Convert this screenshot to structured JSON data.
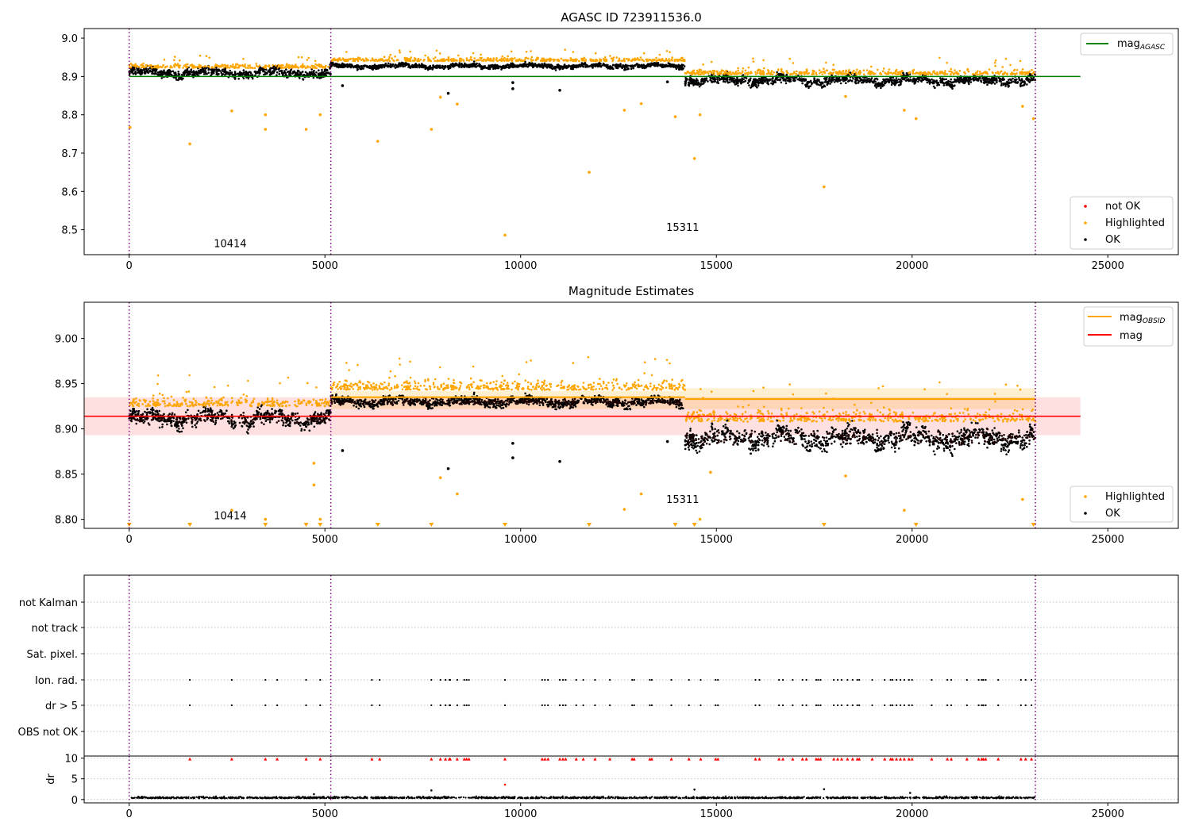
{
  "chart_data": [
    {
      "type": "scatter",
      "title": "AGASC ID 723911536.0",
      "xlim": [
        -1150,
        26800
      ],
      "ylim": [
        8.435,
        9.025
      ],
      "xticks": [
        0,
        5000,
        10000,
        15000,
        20000,
        25000
      ],
      "yticks": [
        8.5,
        8.6,
        8.7,
        8.8,
        8.9,
        9.0
      ],
      "ytick_labels": [
        "8.5",
        "8.6",
        "8.7",
        "8.8",
        "8.9",
        "9.0"
      ],
      "obsid_boundaries": [
        0,
        5150,
        23150
      ],
      "obsid_labels": [
        {
          "text": "10414",
          "x": 2580,
          "y": 8.455
        },
        {
          "text": "15311",
          "x": 14140,
          "y": 8.497
        }
      ],
      "mag_agasc": {
        "name": "mag$_{AGASC}$",
        "label_main": "mag",
        "label_sub": "AGASC",
        "value": 8.9,
        "x": [
          0,
          24300
        ],
        "color": "#008000"
      },
      "segments": [
        {
          "x": [
            0,
            5150
          ],
          "ok_center": 8.909,
          "ok_spread": 0.012,
          "highlight_center": 8.922,
          "highlight_spread": 0.01
        },
        {
          "x": [
            5150,
            14200
          ],
          "ok_center": 8.927,
          "ok_spread": 0.006,
          "highlight_center": 8.94,
          "highlight_spread": 0.008
        },
        {
          "x": [
            14200,
            23150
          ],
          "ok_center": 8.89,
          "ok_spread": 0.012,
          "highlight_center": 8.905,
          "highlight_spread": 0.012
        }
      ],
      "outliers_highlighted": [
        [
          20,
          8.767
        ],
        [
          1550,
          8.724
        ],
        [
          2620,
          8.81
        ],
        [
          3480,
          8.8
        ],
        [
          3480,
          8.762
        ],
        [
          4520,
          8.762
        ],
        [
          4880,
          8.8
        ],
        [
          6350,
          8.731
        ],
        [
          7720,
          8.762
        ],
        [
          7950,
          8.846
        ],
        [
          8380,
          8.828
        ],
        [
          9600,
          8.486
        ],
        [
          11750,
          8.65
        ],
        [
          12650,
          8.812
        ],
        [
          13080,
          8.829
        ],
        [
          13950,
          8.795
        ],
        [
          14440,
          8.686
        ],
        [
          14580,
          8.8
        ],
        [
          17750,
          8.612
        ],
        [
          18300,
          8.848
        ],
        [
          19800,
          8.812
        ],
        [
          20100,
          8.79
        ],
        [
          22820,
          8.822
        ],
        [
          23100,
          8.79
        ]
      ],
      "outliers_ok": [
        [
          5450,
          8.876
        ],
        [
          8150,
          8.856
        ],
        [
          9800,
          8.884
        ],
        [
          9800,
          8.868
        ],
        [
          11000,
          8.864
        ],
        [
          13750,
          8.886
        ]
      ],
      "legend_lines": [
        {
          "name": "mag$_{AGASC}$",
          "color": "#008000"
        }
      ],
      "legend_points": [
        {
          "name": "not OK",
          "color": "#ff0000"
        },
        {
          "name": "Highlighted",
          "color": "#ffa500"
        },
        {
          "name": "OK",
          "color": "#000000"
        }
      ],
      "grid": false
    },
    {
      "type": "scatter",
      "title": "Magnitude Estimates",
      "xlim": [
        -1150,
        26800
      ],
      "ylim": [
        8.79,
        9.04
      ],
      "xticks": [
        0,
        5000,
        10000,
        15000,
        20000,
        25000
      ],
      "yticks": [
        8.8,
        8.85,
        8.9,
        8.95,
        9.0
      ],
      "ytick_labels": [
        "8.80",
        "8.85",
        "8.90",
        "8.95",
        "9.00"
      ],
      "obsid_boundaries": [
        0,
        5150,
        23150
      ],
      "obsid_labels": [
        {
          "text": "10414",
          "x": 2580,
          "y": 8.8
        },
        {
          "text": "15311",
          "x": 14140,
          "y": 8.818
        }
      ],
      "mag": {
        "name": "mag",
        "value": 8.914,
        "band": [
          8.893,
          8.935
        ],
        "x": [
          -1150,
          24300
        ],
        "color": "#ff0000"
      },
      "mag_obsid": {
        "name": "mag$_{OBSID}$",
        "label_main": "mag",
        "label_sub": "OBSID",
        "color": "#ffa500",
        "steps": [
          {
            "x": [
              5150,
              14200
            ],
            "value": 8.935,
            "band": [
              8.922,
              8.942
            ]
          },
          {
            "x": [
              14200,
              23150
            ],
            "value": 8.933,
            "band": [
              8.922,
              8.945
            ]
          }
        ]
      },
      "segments": [
        {
          "x": [
            0,
            5150
          ],
          "ok_center": 8.912,
          "ok_spread": 0.009,
          "highlight_center": 8.925,
          "highlight_spread": 0.01
        },
        {
          "x": [
            5150,
            14200
          ],
          "ok_center": 8.93,
          "ok_spread": 0.005,
          "highlight_center": 8.943,
          "highlight_spread": 0.01
        },
        {
          "x": [
            14200,
            23150
          ],
          "ok_center": 8.89,
          "ok_spread": 0.011,
          "highlight_center": 8.908,
          "highlight_spread": 0.012
        }
      ],
      "outliers_highlighted": [
        [
          2620,
          8.81
        ],
        [
          3480,
          8.8
        ],
        [
          4720,
          8.862
        ],
        [
          4720,
          8.838
        ],
        [
          4880,
          8.8
        ],
        [
          7950,
          8.846
        ],
        [
          8380,
          8.828
        ],
        [
          12650,
          8.811
        ],
        [
          13080,
          8.828
        ],
        [
          14580,
          8.8
        ],
        [
          14850,
          8.852
        ],
        [
          18300,
          8.848
        ],
        [
          19800,
          8.81
        ],
        [
          22820,
          8.822
        ]
      ],
      "outliers_ok": [
        [
          5450,
          8.876
        ],
        [
          8150,
          8.856
        ],
        [
          9800,
          8.884
        ],
        [
          9800,
          8.868
        ],
        [
          11000,
          8.864
        ],
        [
          13750,
          8.886
        ]
      ],
      "floor_markers_x": [
        0,
        1550,
        3480,
        4520,
        4880,
        6350,
        7720,
        9600,
        11750,
        13950,
        14440,
        17750,
        20100,
        23100
      ],
      "legend_lines": [
        {
          "name": "mag$_{OBSID}$",
          "color": "#ffa500"
        },
        {
          "name": "mag",
          "color": "#ff0000"
        }
      ],
      "legend_points": [
        {
          "name": "Highlighted",
          "color": "#ffa500"
        },
        {
          "name": "OK",
          "color": "#000000"
        }
      ],
      "grid": false
    },
    {
      "type": "scatter",
      "title": "",
      "xlim": [
        -1150,
        26800
      ],
      "xticks": [
        0,
        5000,
        10000,
        15000,
        20000,
        25000
      ],
      "obsid_boundaries": [
        0,
        5150,
        23150
      ],
      "flag_categories": [
        "not Kalman",
        "not track",
        "Sat. pixel.",
        "Ion. rad.",
        "dr > 5",
        "OBS not OK"
      ],
      "flag_events_x": [
        1550,
        2620,
        3480,
        3780,
        4520,
        4880,
        6200,
        6400,
        7720,
        7950,
        8080,
        8180,
        8200,
        8380,
        8560,
        8620,
        8680,
        9600,
        10550,
        10620,
        10700,
        11000,
        11080,
        11150,
        11420,
        11600,
        11900,
        12280,
        12850,
        12900,
        13300,
        13350,
        13850,
        14300,
        14600,
        14980,
        15040,
        16000,
        16100,
        16600,
        16700,
        16950,
        17200,
        17300,
        17550,
        17600,
        17660,
        18000,
        18100,
        18200,
        18350,
        18480,
        18600,
        18650,
        18980,
        19300,
        19450,
        19500,
        19600,
        19700,
        19800,
        19920,
        20000,
        20500,
        20900,
        21000,
        21400,
        21700,
        21780,
        21820,
        21880,
        22200,
        22780,
        22900,
        23050
      ],
      "dr_panel": {
        "ylabel": "dr",
        "yticks": [
          0,
          5,
          10
        ],
        "ylim": [
          -0.8,
          10.5
        ],
        "cap": 9.8,
        "baseline": 0.3,
        "outliers": [
          [
            7720,
            2.2
          ],
          [
            4720,
            1.3
          ],
          [
            9600,
            3.6
          ],
          [
            14440,
            2.4
          ],
          [
            17750,
            2.5
          ],
          [
            19950,
            1.6
          ]
        ]
      },
      "grid": true
    }
  ]
}
